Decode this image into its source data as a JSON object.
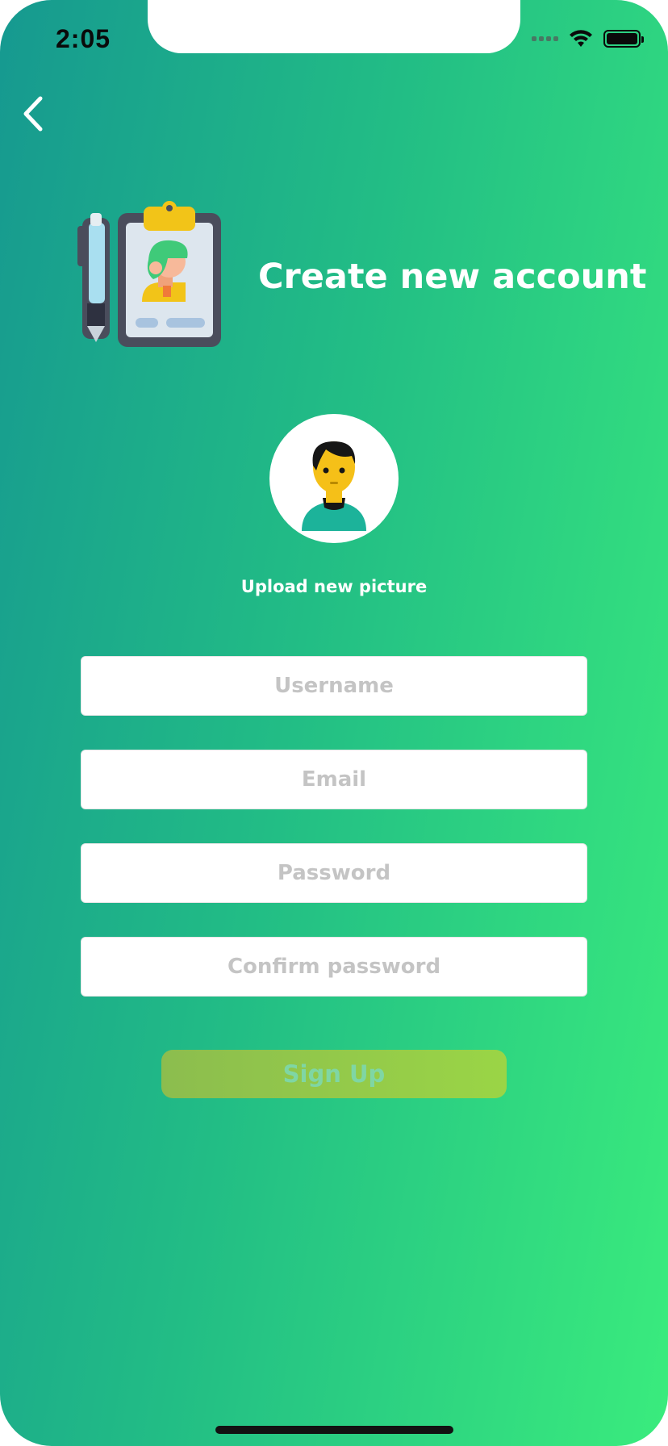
{
  "status_bar": {
    "time": "2:05",
    "icons": [
      "signal-icon",
      "wifi-icon",
      "battery-icon"
    ]
  },
  "nav": {
    "back_icon": "chevron-left-icon"
  },
  "header": {
    "illustration_icon": "clipboard-profile-icon",
    "title": "Create new account"
  },
  "avatar": {
    "icon": "user-avatar-icon",
    "upload_label": "Upload new picture"
  },
  "form": {
    "username": {
      "placeholder": "Username",
      "value": ""
    },
    "email": {
      "placeholder": "Email",
      "value": ""
    },
    "password": {
      "placeholder": "Password",
      "value": ""
    },
    "confirm_password": {
      "placeholder": "Confirm password",
      "value": ""
    }
  },
  "actions": {
    "signup_label": "Sign Up"
  },
  "colors": {
    "gradient_start": "#169990",
    "gradient_end": "#3aec7d",
    "button_start": "#8cbd4e",
    "button_end": "#9ad546",
    "button_text": "#7fd6a4",
    "placeholder": "#c4c4c4"
  }
}
